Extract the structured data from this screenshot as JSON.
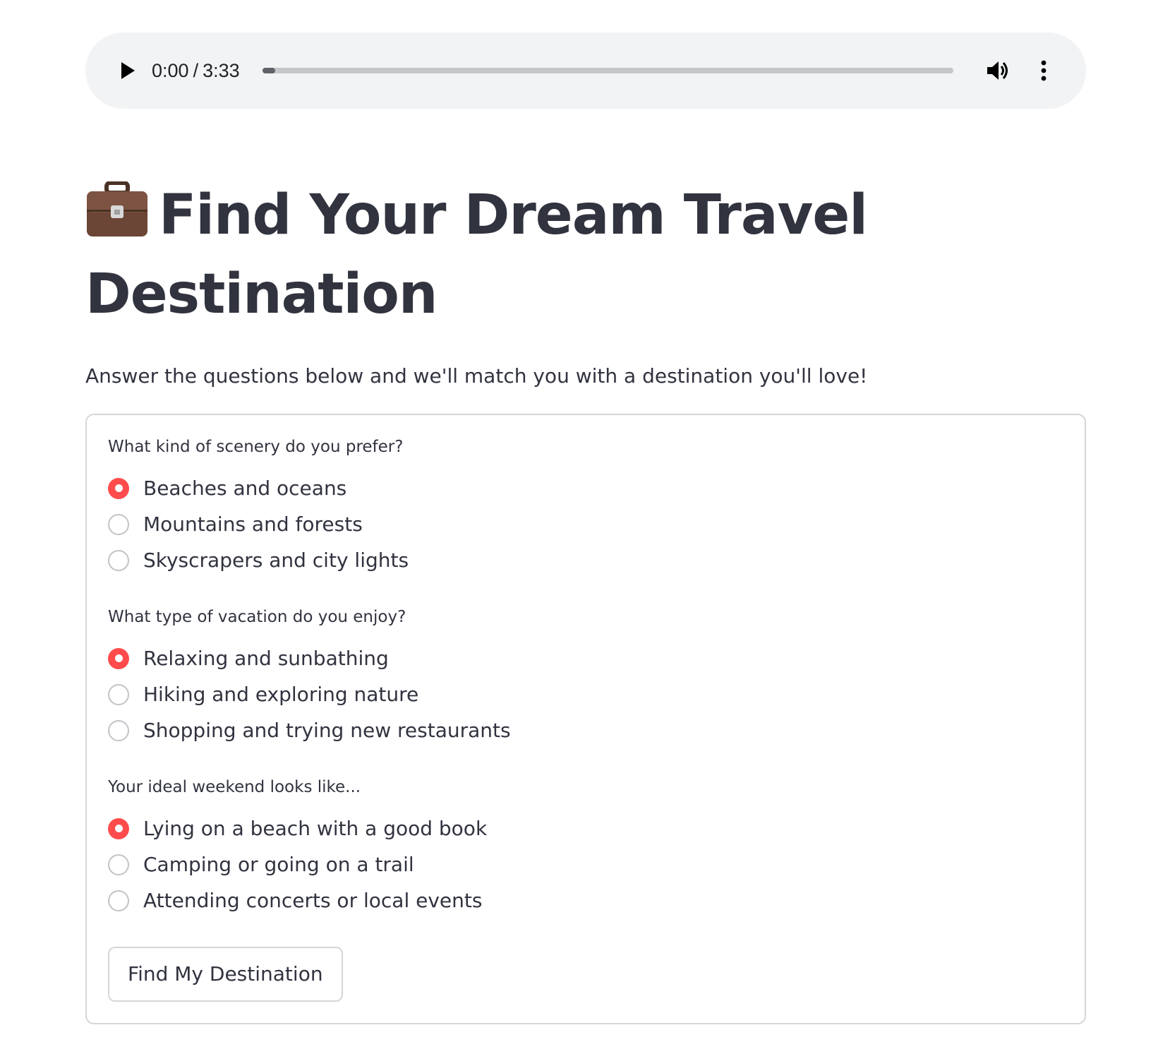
{
  "audio": {
    "current_time": "0:00",
    "separator": "/",
    "duration": "3:33",
    "progress_fraction": 0.0,
    "play_icon": "play-icon",
    "volume_icon": "volume-icon",
    "more_icon": "more-vertical-icon"
  },
  "header": {
    "emoji_icon": "briefcase-icon",
    "title": "Find Your Dream Travel Destination",
    "subtitle": "Answer the questions below and we'll match you with a destination you'll love!"
  },
  "form": {
    "questions": [
      {
        "label": "What kind of scenery do you prefer?",
        "options": [
          "Beaches and oceans",
          "Mountains and forests",
          "Skyscrapers and city lights"
        ],
        "selected_index": 0
      },
      {
        "label": "What type of vacation do you enjoy?",
        "options": [
          "Relaxing and sunbathing",
          "Hiking and exploring nature",
          "Shopping and trying new restaurants"
        ],
        "selected_index": 0
      },
      {
        "label": "Your ideal weekend looks like...",
        "options": [
          "Lying on a beach with a good book",
          "Camping or going on a trail",
          "Attending concerts or local events"
        ],
        "selected_index": 0
      }
    ],
    "submit_label": "Find My Destination"
  },
  "colors": {
    "accent": "#ff4b4b",
    "text": "#31333f",
    "player_bg": "#f1f3f4",
    "border": "#d6d6d9"
  }
}
